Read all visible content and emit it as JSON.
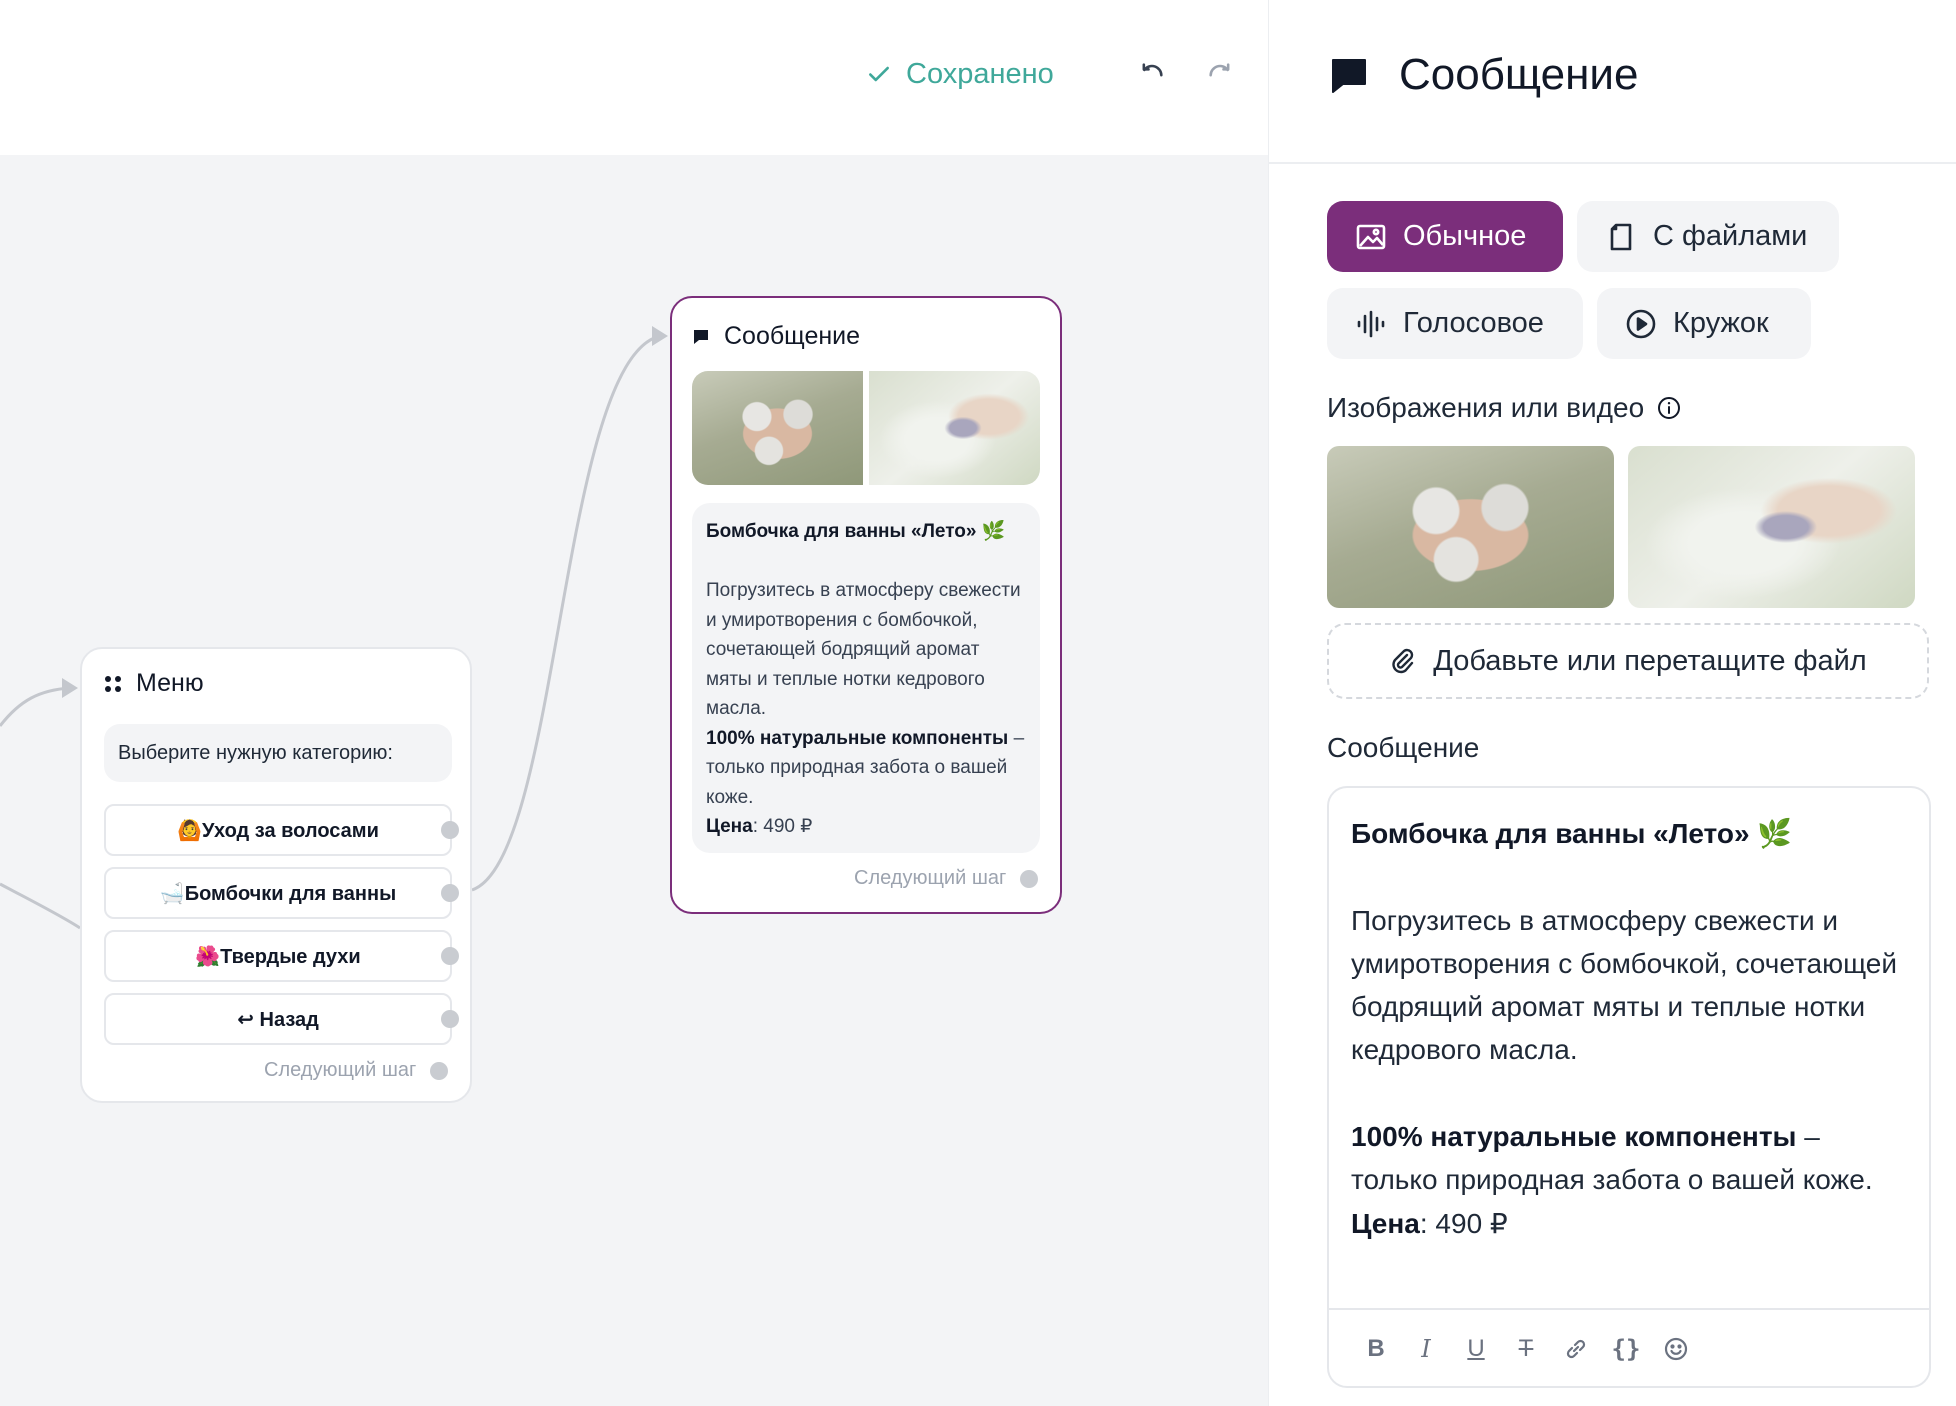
{
  "toolbar_top": {
    "saved_label": "Сохранено"
  },
  "canvas": {
    "menu_node": {
      "title": "Меню",
      "prompt": "Выберите нужную категорию:",
      "buttons": [
        {
          "label": "🙆Уход за волосами"
        },
        {
          "label": "🛁Бомбочки для ванны"
        },
        {
          "label": "🌺Твердые духи"
        },
        {
          "label": "↩ Назад"
        }
      ],
      "next_step": "Следующий шаг"
    },
    "message_node": {
      "title": "Сообщение",
      "body": {
        "title_line": "Бомбочка для ванны «Лето» 🌿",
        "paragraph": "Погрузитесь в атмосферу свежести и умиротворения с бомбочкой, сочетающей бодрящий аромат мяты и теплые нотки кедрового масла.",
        "bold_lead": "100% натуральные компоненты",
        "lead_rest": " – только природная забота о вашей коже.",
        "price_label": "Цена",
        "price_value": ": 490 ₽"
      },
      "next_step": "Следующий шаг"
    }
  },
  "panel": {
    "title": "Сообщение",
    "types": [
      {
        "label": "Обычное",
        "icon": "image-icon",
        "active": true
      },
      {
        "label": "С файлами",
        "icon": "file-icon",
        "active": false
      },
      {
        "label": "Голосовое",
        "icon": "voice-wave-icon",
        "active": false
      },
      {
        "label": "Кружок",
        "icon": "play-circle-icon",
        "active": false
      }
    ],
    "media_label": "Изображения или видео",
    "dropzone_label": "Добавьте или перетащите файл",
    "message_label": "Сообщение",
    "editor": {
      "title_line": "Бомбочка для ванны «Лето» 🌿",
      "paragraph": "Погрузитесь в атмосферу свежести и умиротворения с бомбочкой, сочетающей бодрящий аромат мяты и теплые нотки кедрового масла.",
      "bold_lead": "100% натуральные компоненты",
      "lead_rest": " – только природная забота о вашей коже.",
      "price_label": "Цена",
      "price_value": ": 490 ₽"
    },
    "format_tools": [
      "B",
      "I",
      "U",
      "T",
      "link",
      "{}",
      "emoji"
    ]
  },
  "colors": {
    "accent": "#7b2e7b",
    "saved": "#3fa89a",
    "canvas_bg": "#f3f4f6",
    "port": "#c9ccd1"
  }
}
